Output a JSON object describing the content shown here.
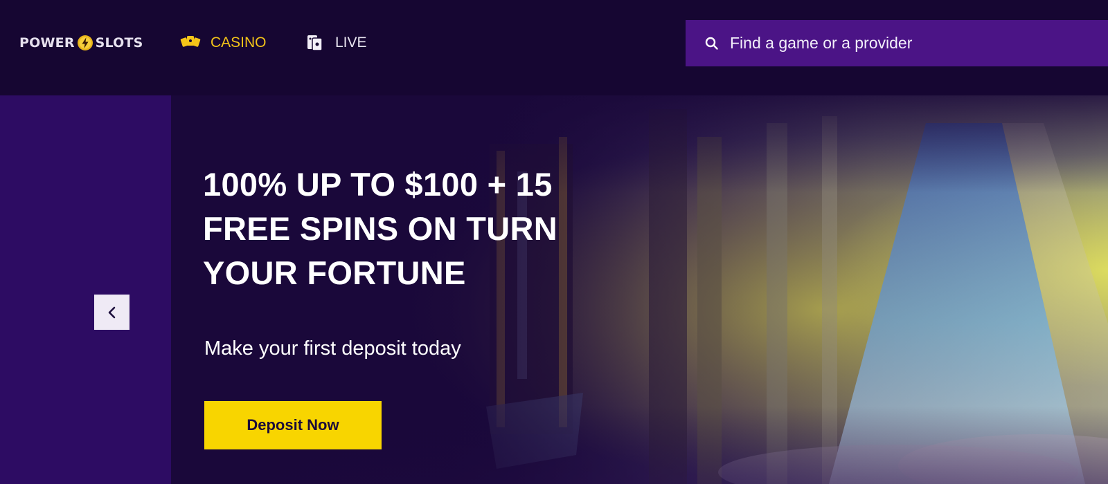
{
  "header": {
    "logo": {
      "part1": "POWER",
      "part2": "SLOTS",
      "icon": "lightning-bolt-icon"
    },
    "nav": [
      {
        "label": "CASINO",
        "icon": "casino-cards-icon",
        "active": true,
        "color": "#f5c518"
      },
      {
        "label": "LIVE",
        "icon": "live-cards-icon",
        "active": false,
        "color": "#e8e4f0"
      }
    ],
    "search": {
      "placeholder": "Find a game or a provider",
      "value": "",
      "icon": "search-icon"
    }
  },
  "hero": {
    "title": "100% UP TO $100 + 15 FREE SPINS ON TURN YOUR FORTUNE",
    "subtitle": "Make your first deposit today",
    "cta_label": "Deposit Now",
    "prev_icon": "chevron-left-icon"
  },
  "colors": {
    "background": "#180735",
    "header": "#160632",
    "search_bg": "#4b1486",
    "side_strip": "#2d0c63",
    "accent_yellow": "#f8d500"
  }
}
